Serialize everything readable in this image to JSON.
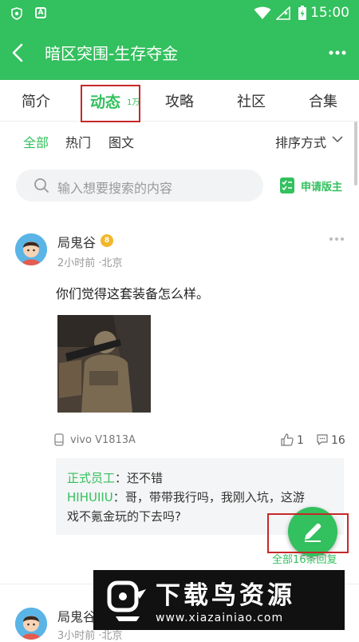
{
  "status_bar": {
    "time": "15:00",
    "badge_letter": "A",
    "icons": [
      "shield-icon",
      "font-icon",
      "wifi-icon",
      "signal-icon",
      "battery-charging-icon"
    ]
  },
  "app_bar": {
    "title": "暗区突围-生存夺金",
    "back_icon": "back-arrow-icon",
    "more_icon": "more-icon"
  },
  "tabs": [
    {
      "label": "简介"
    },
    {
      "label": "动态",
      "badge": "1万",
      "active": true
    },
    {
      "label": "攻略"
    },
    {
      "label": "社区"
    },
    {
      "label": "合集"
    }
  ],
  "filters": {
    "items": [
      {
        "label": "全部",
        "active": true
      },
      {
        "label": "热门"
      },
      {
        "label": "图文"
      }
    ],
    "sort_label": "排序方式"
  },
  "search": {
    "placeholder": "输入想要搜索的内容"
  },
  "apply_moderator": {
    "label": "申请版主"
  },
  "posts": [
    {
      "username": "局鬼谷",
      "level": "8",
      "meta": "2小时前 ·北京",
      "content": "你们觉得这套装备怎么样。",
      "device": "vivo V1813A",
      "likes": "1",
      "comment_count": "16",
      "comments": [
        {
          "author": "正式员工",
          "text": "还不错"
        },
        {
          "author": "HIHUIIU",
          "text": "哥，带带我行吗，我刚入坑，这游",
          "text_cont": "戏不氪金玩的下去吗?"
        }
      ],
      "all_replies": "全部16条回复"
    },
    {
      "username": "局鬼谷",
      "meta": "3小时前 ·北京"
    }
  ],
  "watermark": {
    "title": "下载鸟资源",
    "url": "www.xiazainiao.com"
  },
  "colors": {
    "accent": "#33c05e",
    "annotation": "#c62828"
  }
}
